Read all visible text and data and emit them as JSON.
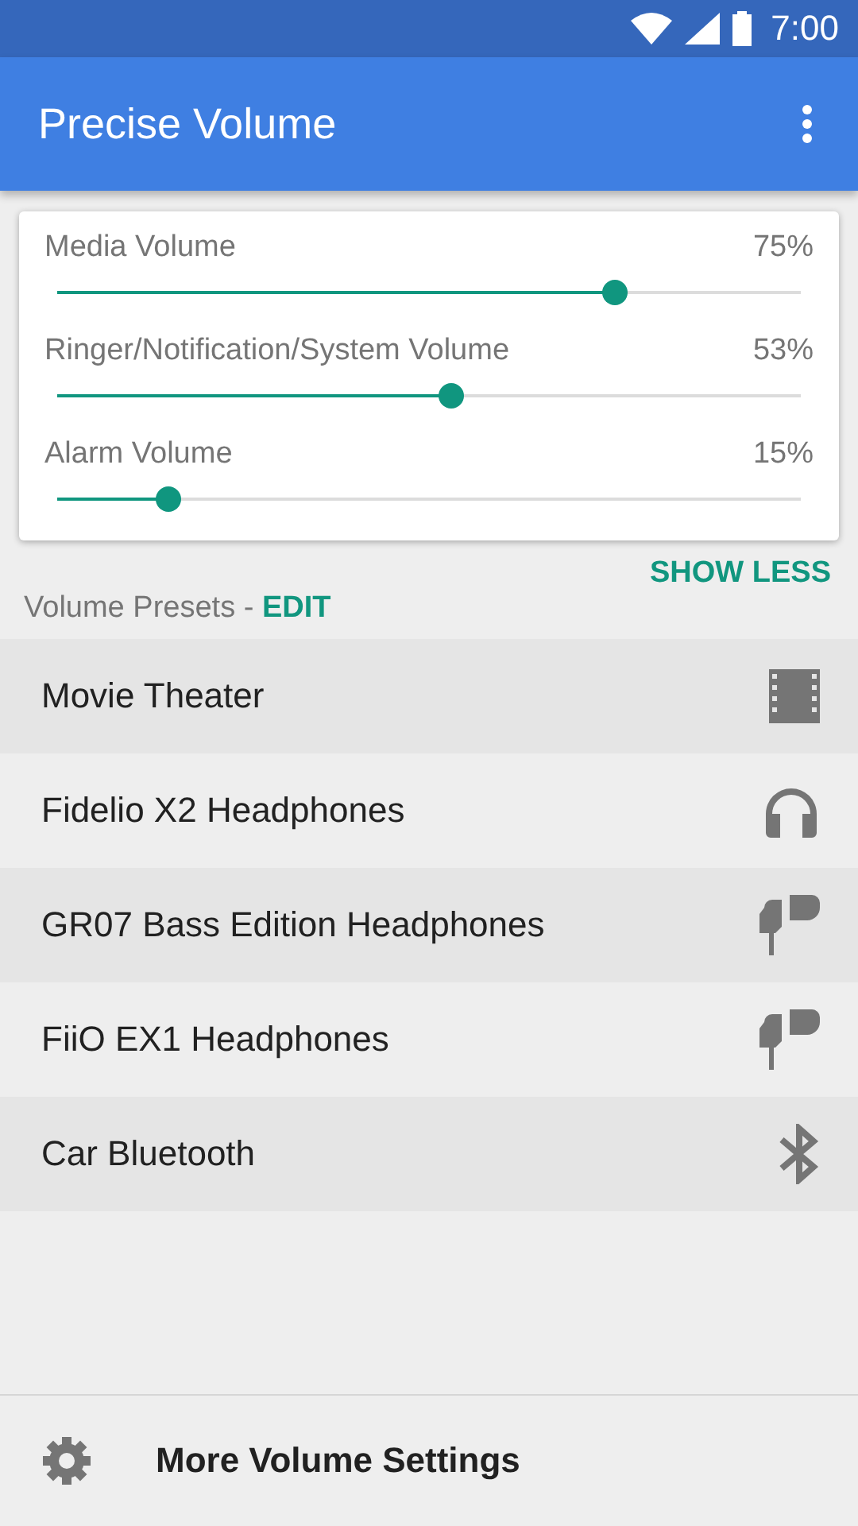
{
  "status_bar": {
    "time": "7:00"
  },
  "app_bar": {
    "title": "Precise Volume"
  },
  "volumes": [
    {
      "name": "Media Volume",
      "reading": "75%",
      "level": 0.75
    },
    {
      "name": "Ringer/Notification/System Volume",
      "reading": "53%",
      "level": 0.53
    },
    {
      "name": "Alarm Volume",
      "reading": "15%",
      "level": 0.15
    }
  ],
  "show_less": "SHOW LESS",
  "presets_header": {
    "label": "Volume Presets - ",
    "action": "EDIT"
  },
  "presets": [
    {
      "name": "Movie Theater",
      "kind": "film"
    },
    {
      "name": "Fidelio X2 Headphones",
      "kind": "headphones"
    },
    {
      "name": "GR07 Bass Edition Headphones",
      "kind": "earbud"
    },
    {
      "name": "FiiO EX1 Headphones",
      "kind": "earbud"
    },
    {
      "name": "Car Bluetooth",
      "kind": "bluetooth"
    }
  ],
  "footer": {
    "label": "More Volume Settings"
  }
}
